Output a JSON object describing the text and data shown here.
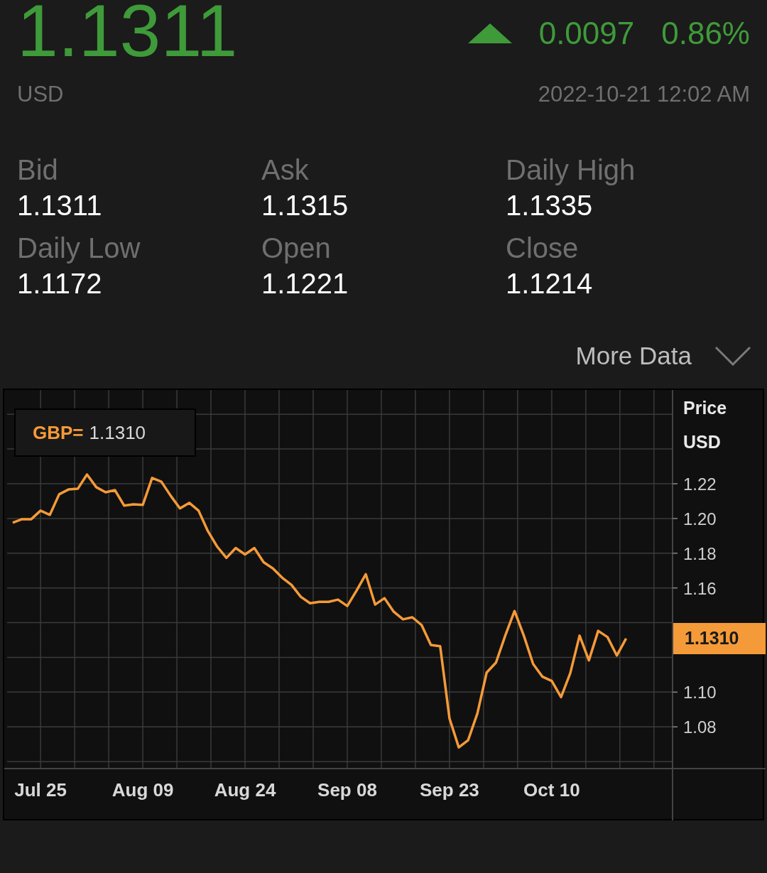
{
  "quote": {
    "price": "1.1311",
    "rising": true,
    "change": "0.0097",
    "change_pct": "0.86%",
    "currency": "USD",
    "timestamp": "2022-10-21 12:02 AM"
  },
  "stats": [
    {
      "label": "Bid",
      "value": "1.1311"
    },
    {
      "label": "Ask",
      "value": "1.1315"
    },
    {
      "label": "Daily High",
      "value": "1.1335"
    },
    {
      "label": "Daily Low",
      "value": "1.1172"
    },
    {
      "label": "Open",
      "value": "1.1221"
    },
    {
      "label": "Close",
      "value": "1.1214"
    }
  ],
  "more_data": {
    "label": "More Data",
    "expanded": false
  },
  "chart": {
    "legend": {
      "value": "1.1310"
    },
    "axis_title": "Price",
    "axis_unit": "USD",
    "last_badge": "1.1310",
    "chart_data": {
      "type": "line",
      "grid": true,
      "ylim": [
        1.0261,
        1.274
      ],
      "yticks": [
        1.08,
        {
          "value": 1.1,
          "label": "1.10"
        },
        1.16,
        1.18,
        {
          "value": 1.2,
          "label": "1.20"
        },
        1.22
      ],
      "categories": [
        null,
        null,
        null,
        "Jul 25",
        null,
        null,
        null,
        null,
        null,
        null,
        null,
        null,
        null,
        null,
        "Aug 09",
        null,
        null,
        null,
        null,
        null,
        null,
        null,
        null,
        null,
        null,
        "Aug 24",
        null,
        null,
        null,
        null,
        null,
        null,
        null,
        null,
        null,
        null,
        "Sep 08",
        null,
        null,
        null,
        null,
        null,
        null,
        null,
        null,
        null,
        null,
        "Sep 23",
        null,
        null,
        null,
        null,
        null,
        null,
        null,
        null,
        null,
        null,
        "Oct 10",
        null,
        null,
        null,
        null,
        null,
        null,
        null,
        null
      ],
      "series": [
        {
          "name": "GBP=",
          "color": "#f59a38",
          "values": [
            1.1976,
            1.1996,
            1.1996,
            1.2045,
            1.2021,
            1.2139,
            1.2167,
            1.2171,
            1.2253,
            1.218,
            1.2151,
            1.2163,
            1.2074,
            1.2082,
            1.2078,
            1.2233,
            1.2212,
            1.2131,
            1.2058,
            1.209,
            1.2045,
            1.1927,
            1.1838,
            1.1773,
            1.183,
            1.1793,
            1.183,
            1.1748,
            1.1712,
            1.1659,
            1.1618,
            1.1549,
            1.1512,
            1.152,
            1.152,
            1.1533,
            1.1496,
            1.1585,
            1.1679,
            1.1504,
            1.1541,
            1.1463,
            1.1419,
            1.1431,
            1.1386,
            1.1272,
            1.1264,
            1.0849,
            1.0682,
            1.0723,
            1.0877,
            1.1113,
            1.117,
            1.1325,
            1.1467,
            1.1325,
            1.1162,
            1.1089,
            1.1064,
            1.0971,
            1.1109,
            1.1325,
            1.1183,
            1.1353,
            1.1317,
            1.1211,
            1.1309
          ]
        }
      ]
    }
  }
}
